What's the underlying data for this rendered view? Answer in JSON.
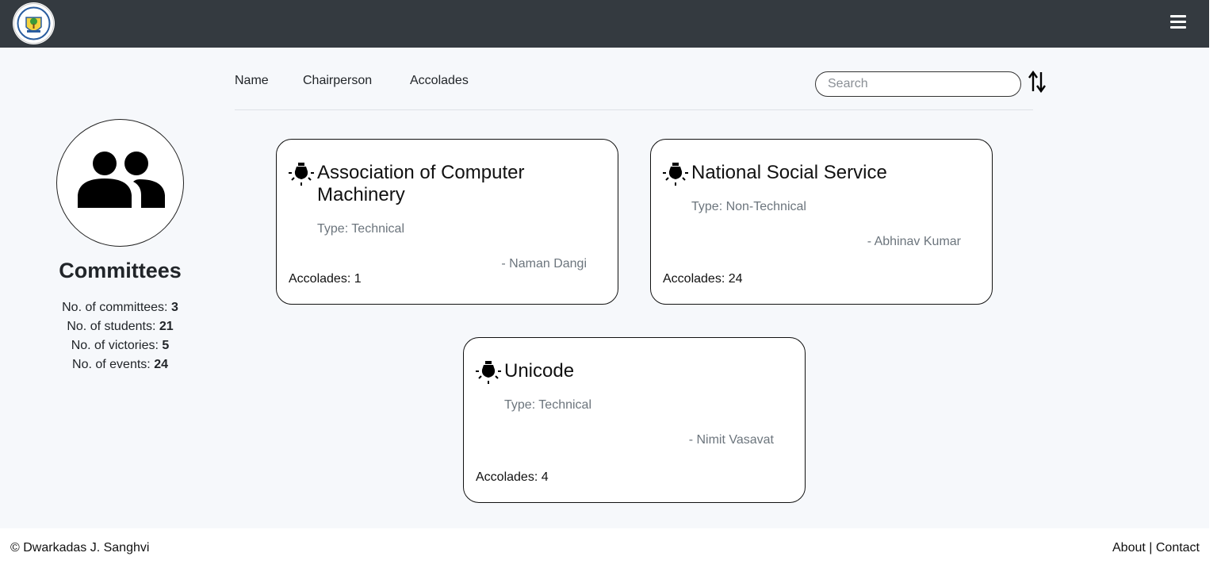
{
  "navbar": {
    "logo_icon": "college-emblem-icon",
    "menu_icon": "hamburger-menu-icon"
  },
  "sidebar": {
    "avatar_icon": "group-users-icon",
    "title": "Committees",
    "stats": [
      {
        "label": "No. of committees: ",
        "value": "3"
      },
      {
        "label": "No. of students: ",
        "value": "21"
      },
      {
        "label": "No. of victories: ",
        "value": "5"
      },
      {
        "label": "No. of events: ",
        "value": "24"
      }
    ]
  },
  "sort_bar": {
    "options": [
      "Name",
      "Chairperson",
      "Accolades"
    ],
    "search_placeholder": "Search",
    "search_value": "",
    "sort_icon": "sort-arrows-icon"
  },
  "committees": [
    {
      "name": "Association of Computer Machinery",
      "type": "Type: Technical",
      "chairperson": "- Naman Dangi",
      "accolades": "Accolades: 1",
      "icon": "lightbulb-icon"
    },
    {
      "name": "National Social Service",
      "type": "Type: Non-Technical",
      "chairperson": "- Abhinav Kumar",
      "accolades": "Accolades: 24",
      "icon": "lightbulb-icon"
    },
    {
      "name": "Unicode",
      "type": "Type: Technical",
      "chairperson": "- Nimit Vasavat",
      "accolades": "Accolades: 4",
      "icon": "lightbulb-icon"
    }
  ],
  "footer": {
    "copyright": "© Dwarkadas J. Sanghvi",
    "about": "About",
    "separator": " | ",
    "contact": "Contact"
  },
  "colors": {
    "navbar_bg": "#343a40",
    "page_bg": "#f6f8fb",
    "card_border": "#111111",
    "muted_text": "#6c757d"
  }
}
